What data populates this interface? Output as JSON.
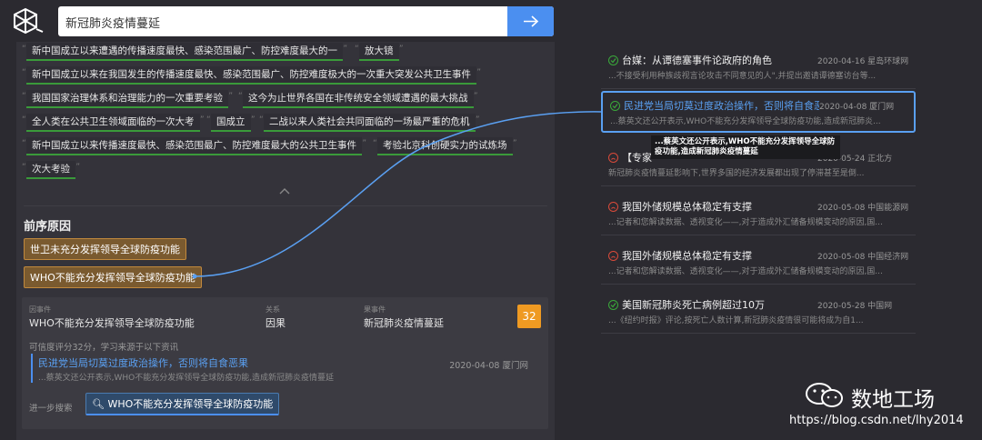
{
  "search": {
    "query": "新冠肺炎疫情蔓延"
  },
  "tags": [
    [
      "新中国成立以来遭遇的传播速度最快、感染范围最广、防控难度最大的一",
      "放大镜"
    ],
    [
      "新中国成立以来在我国发生的传播速度最快、感染范围最广、防控难度极大的一次重大突发公共卫生事件"
    ],
    [
      "我国国家治理体系和治理能力的一次重要考验",
      "这今为止世界各国在非传统安全领域遭遇的最大挑战"
    ],
    [
      "全人类在公共卫生领域面临的一次大考",
      "国成立",
      "二战以来人类社会共同面临的一场最严重的危机"
    ],
    [
      "新中国成立以来传播速度最快、感染范围最广、防控难度最大的公共卫生事件",
      "考验北京科创硬实力的试炼场"
    ],
    [
      "次大考验"
    ]
  ],
  "causes": {
    "title": "前序原因",
    "items": [
      "世卫未充分发挥领导全球防疫功能",
      "WHO不能充分发挥领导全球防疫功能"
    ]
  },
  "card": {
    "cause_label": "因事件",
    "cause_value": "WHO不能充分发挥领导全球防疫功能",
    "relation_label": "关系",
    "relation_value": "因果",
    "effect_label": "果事件",
    "effect_value": "新冠肺炎疫情蔓延",
    "score": "32",
    "note": "可信度评分32分，学习来源于以下资讯",
    "evidence": {
      "title": "民进党当局切莫过度政治操作，否则将自食恶果",
      "date": "2020-04-08 厦门网",
      "snippet": "...蔡英文还公开表示,WHO不能充分发挥领导全球防疫功能,造成新冠肺炎疫情蔓延"
    },
    "further_label": "进一步搜索",
    "further_button": "WHO不能充分发挥领导全球防疫功能"
  },
  "news": [
    {
      "title": "台媒：从谭德塞事件论政府的角色",
      "date": "2020-04-16  星岛环球网",
      "snippet": "...不接受利用种族歧视言论攻击不同意见的人\",并提出邀请谭德塞访台等...",
      "status": "ok"
    },
    {
      "title": "民进党当局切莫过度政治操作，否则将自食恶果",
      "date": "2020-04-08  厦门网",
      "snippet": "...蔡英文还公开表示,WHO不能充分发挥领导全球防疫功能,造成新冠肺炎...",
      "status": "ok"
    },
    {
      "title": "【专家",
      "date": "2020-05-24  正北方",
      "snippet": "新冠肺炎疫情蔓延影响下,世界多国的经济发展都出现了停滞甚至是倒...",
      "status": "bad"
    },
    {
      "title": "我国外储规模总体稳定有支撑",
      "date": "2020-05-08  中国能源网",
      "snippet": "...记者和您解读数据、透视变化——,对于造成外汇储备规模变动的原因,国...",
      "status": "bad"
    },
    {
      "title": "我国外储规模总体稳定有支撑",
      "date": "2020-05-08  中国经济网",
      "snippet": "...记者和您解读数据、透视变化——,对于造成外汇储备规模变动的原因,国...",
      "status": "bad"
    },
    {
      "title": "美国新冠肺炎死亡病例超过10万",
      "date": "2020-05-28  中国网",
      "snippet": "...《纽约时报》评论,按死亡人数计算,新冠肺炎疫情很可能将成为自1...",
      "status": "ok"
    }
  ],
  "tooltip": "...蔡英文还公开表示,WHO不能充分发挥领导全球防疫功能,造成新冠肺炎疫情蔓延",
  "watermark": {
    "brand": "数地工场",
    "url": "https://blog.csdn.net/lhy2014"
  },
  "colors": {
    "accent": "#4b8ff0",
    "cause_tag": "#c1893d",
    "ok": "#3aa83a",
    "bad": "#d94a3a",
    "score": "#ef9a22"
  }
}
